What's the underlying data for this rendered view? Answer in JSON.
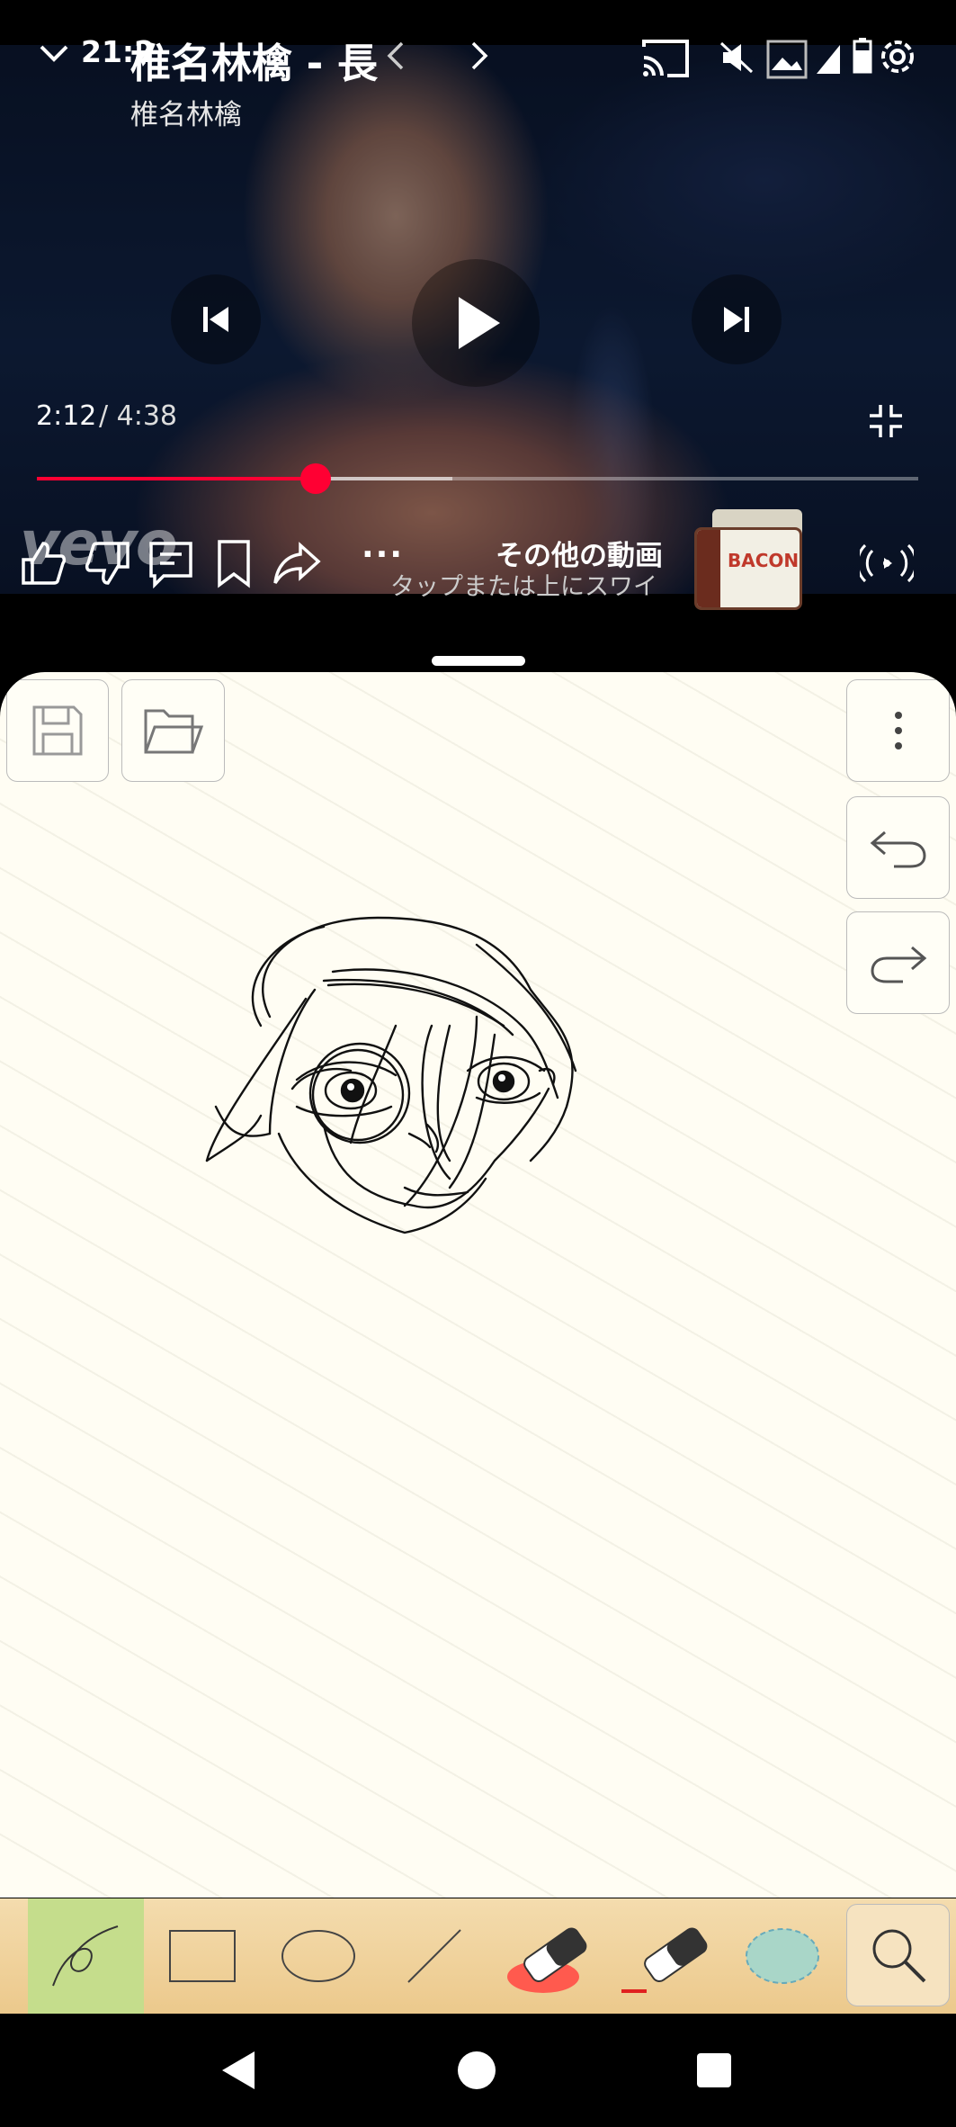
{
  "status_bar": {
    "clock": "21:2",
    "icons": [
      "cast-icon",
      "mute-icon",
      "image-notification-icon",
      "signal-icon",
      "battery-icon",
      "settings-icon"
    ]
  },
  "video": {
    "title": "椎名林檎 - 長",
    "channel": "椎名林檎",
    "time_current": "2:12",
    "time_total": "/ 4:38",
    "progress_played": 0.316,
    "progress_buffered": 0.471,
    "watermark": "vevo",
    "more_videos_title": "その他の動画",
    "more_videos_sub": "タップまたは上にスワイ…",
    "thumbnail_text": "BACON",
    "more_label": "···",
    "accent_color": "#ff0033"
  },
  "drawing_app": {
    "toolbar_tools": [
      "pen-tool",
      "rectangle-tool",
      "ellipse-tool",
      "line-tool",
      "eraser-tool",
      "eraser-size-tool",
      "color-picker",
      "zoom-tool"
    ],
    "selected_tool": "pen-tool",
    "selected_color": "#c5dd8c",
    "eraser_color": "#ff5a4e",
    "fill_color": "#a9d6c8"
  },
  "nav_bar": {
    "buttons": [
      "back-button",
      "home-button",
      "recents-button"
    ]
  }
}
